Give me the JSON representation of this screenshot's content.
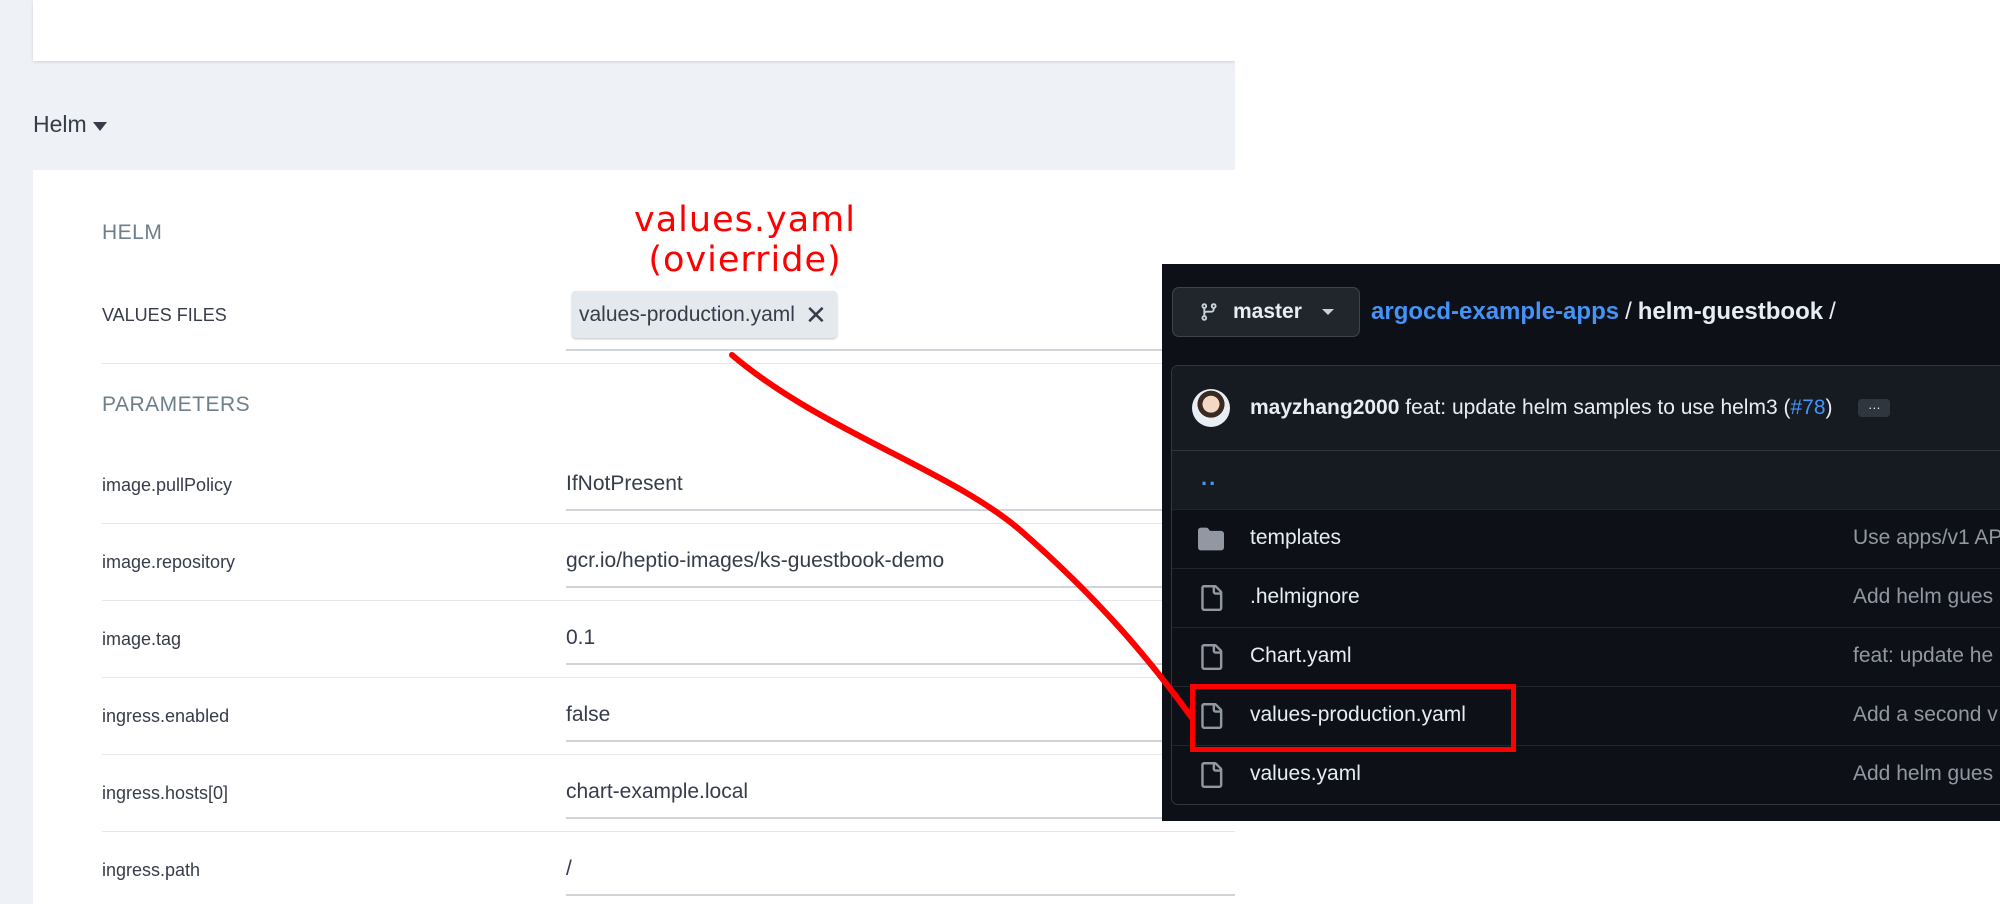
{
  "argocd": {
    "section_toggle": "Helm",
    "card_title": "HELM",
    "values_files_label": "VALUES FILES",
    "values_files": [
      "values-production.yaml"
    ],
    "remove_chip_icon": "close-icon",
    "parameters_title": "PARAMETERS",
    "parameters": [
      {
        "name": "image.pullPolicy",
        "value": "IfNotPresent"
      },
      {
        "name": "image.repository",
        "value": "gcr.io/heptio-images/ks-guestbook-demo"
      },
      {
        "name": "image.tag",
        "value": "0.1"
      },
      {
        "name": "ingress.enabled",
        "value": "false"
      },
      {
        "name": "ingress.hosts[0]",
        "value": "chart-example.local"
      },
      {
        "name": "ingress.path",
        "value": "/"
      }
    ]
  },
  "annotation": {
    "line1": "values.yaml",
    "line2": "(ovierride)",
    "color": "#ff0000"
  },
  "github": {
    "branch": "master",
    "breadcrumb": {
      "repo": "argocd-example-apps",
      "sep": "/",
      "dir": "helm-guestbook",
      "trail": "/"
    },
    "commit": {
      "author": "mayzhang2000",
      "message": "feat: update helm samples to use helm3 (",
      "pr": "#78",
      "close": ")",
      "more": "…"
    },
    "parent_dir": "..",
    "files": [
      {
        "name": "templates",
        "type": "folder",
        "msg": "Use apps/v1 AP"
      },
      {
        "name": ".helmignore",
        "type": "file",
        "msg": "Add helm gues"
      },
      {
        "name": "Chart.yaml",
        "type": "file",
        "msg": "feat: update he"
      },
      {
        "name": "values-production.yaml",
        "type": "file",
        "msg": "Add a second v"
      },
      {
        "name": "values.yaml",
        "type": "file",
        "msg": "Add helm gues"
      }
    ],
    "colors": {
      "bg": "#0d1117",
      "link": "#4493f8",
      "text": "#e6edf3",
      "muted": "#9198a1"
    }
  }
}
